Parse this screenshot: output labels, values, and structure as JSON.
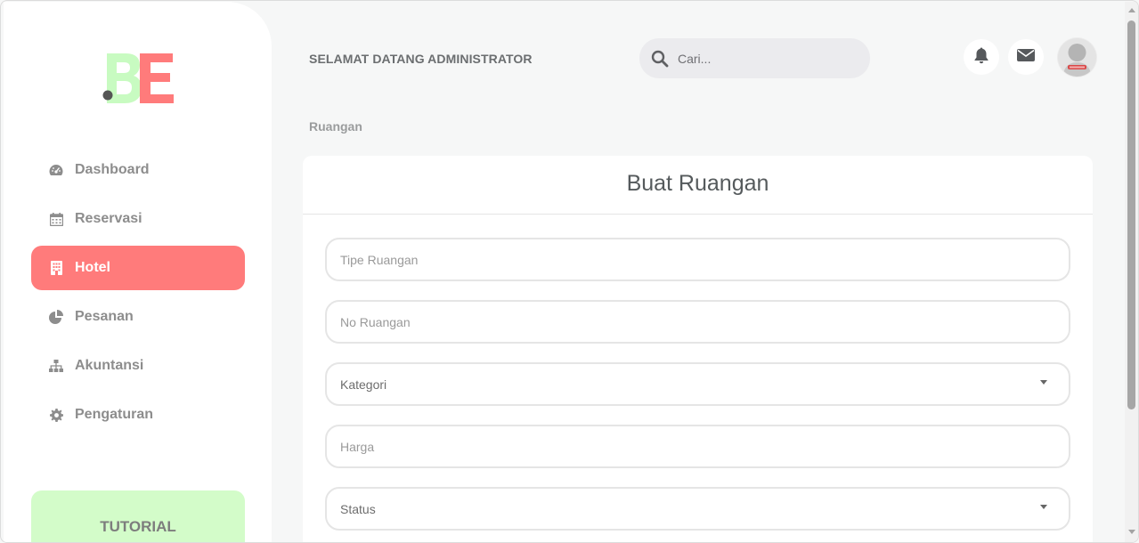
{
  "brand": {
    "logo_text": "BE",
    "colors": {
      "green": "#c8fbc1",
      "red": "#ff7b7b",
      "dot": "#555555"
    }
  },
  "sidebar": {
    "items": [
      {
        "label": "Dashboard",
        "icon": "dashboard-gauge-icon",
        "active": false
      },
      {
        "label": "Reservasi",
        "icon": "calendar-icon",
        "active": false
      },
      {
        "label": "Hotel",
        "icon": "building-icon",
        "active": true
      },
      {
        "label": "Pesanan",
        "icon": "pie-chart-icon",
        "active": false
      },
      {
        "label": "Akuntansi",
        "icon": "sitemap-icon",
        "active": false
      },
      {
        "label": "Pengaturan",
        "icon": "gear-icon",
        "active": false
      }
    ],
    "tutorial_label": "TUTORIAL"
  },
  "header": {
    "welcome": "SELAMAT DATANG ADMINISTRATOR",
    "search_placeholder": "Cari..."
  },
  "breadcrumb": "Ruangan",
  "form": {
    "title": "Buat Ruangan",
    "fields": [
      {
        "placeholder": "Tipe Ruangan",
        "type": "text"
      },
      {
        "placeholder": "No Ruangan",
        "type": "text"
      },
      {
        "label": "Kategori",
        "type": "select"
      },
      {
        "placeholder": "Harga",
        "type": "text"
      },
      {
        "label": "Status",
        "type": "select"
      }
    ]
  },
  "accent": "#ff7b7b"
}
